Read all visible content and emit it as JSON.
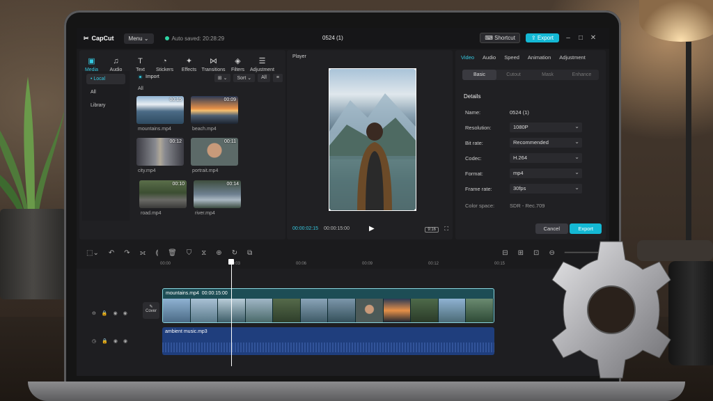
{
  "app": {
    "name": "CapCut",
    "menu_label": "Menu",
    "autosave": "Auto saved: 20:28:29",
    "project_title": "0524 (1)",
    "shortcut_label": "Shortcut",
    "export_label": "Export"
  },
  "toolbar": [
    {
      "label": "Media",
      "icon": "media-icon",
      "glyph": "▣"
    },
    {
      "label": "Audio",
      "icon": "audio-icon",
      "glyph": "♫"
    },
    {
      "label": "Text",
      "icon": "text-icon",
      "glyph": "T"
    },
    {
      "label": "Stickers",
      "icon": "sticker-icon",
      "glyph": "◔"
    },
    {
      "label": "Effects",
      "icon": "effects-icon",
      "glyph": "✦"
    },
    {
      "label": "Transitions",
      "icon": "transitions-icon",
      "glyph": "⋈"
    },
    {
      "label": "Filters",
      "icon": "filters-icon",
      "glyph": "◈"
    },
    {
      "label": "Adjustment",
      "icon": "adjustment-icon",
      "glyph": "☰"
    }
  ],
  "sidebar": {
    "items": [
      "• Local",
      "All",
      "Library"
    ]
  },
  "media": {
    "import_label": "Import",
    "sort_label": "Sort",
    "filter_label": "All",
    "section_label": "All",
    "items": [
      {
        "name": "mountains.mp4",
        "duration": "00:15"
      },
      {
        "name": "beach.mp4",
        "duration": "00:09"
      },
      {
        "name": "city.mp4",
        "duration": "00:12"
      },
      {
        "name": "portrait.mp4",
        "duration": "00:11"
      },
      {
        "name": "road.mp4",
        "duration": "00:10"
      },
      {
        "name": "river.mp4",
        "duration": "00:14"
      }
    ]
  },
  "player": {
    "label": "Player",
    "current_time": "00:00:02:15",
    "total_time": "00:00:15:00",
    "ratio": "9:16"
  },
  "properties": {
    "tabs": [
      "Video",
      "Audio",
      "Speed",
      "Animation",
      "Adjustment"
    ],
    "subtabs": [
      "Basic",
      "Cutout",
      "Mask",
      "Enhance"
    ],
    "section": "Details",
    "fields": [
      {
        "label": "Name:",
        "value": "0524 (1)",
        "type": "text"
      },
      {
        "label": "Resolution:",
        "value": "1080P",
        "type": "select"
      },
      {
        "label": "Bit rate:",
        "value": "Recommended",
        "type": "select"
      },
      {
        "label": "Codec:",
        "value": "H.264",
        "type": "select"
      },
      {
        "label": "Format:",
        "value": "mp4",
        "type": "select"
      },
      {
        "label": "Frame rate:",
        "value": "30fps",
        "type": "select"
      },
      {
        "label": "Color space:",
        "value": "SDR - Rec.709",
        "type": "text"
      }
    ],
    "cancel_label": "Cancel",
    "export_label": "Export"
  },
  "timeline": {
    "ruler": [
      "00:00",
      "00:03",
      "00:06",
      "00:09",
      "00:12",
      "00:15"
    ],
    "cover_label": "Cover",
    "video_clip": {
      "name": "mountains.mp4",
      "duration": "00:00:15:00"
    },
    "audio_clip": {
      "name": "ambient music.mp3"
    }
  },
  "colors": {
    "accent": "#14b8d4",
    "video_clip": "#1d4d55",
    "audio_clip": "#1f3e7d"
  }
}
